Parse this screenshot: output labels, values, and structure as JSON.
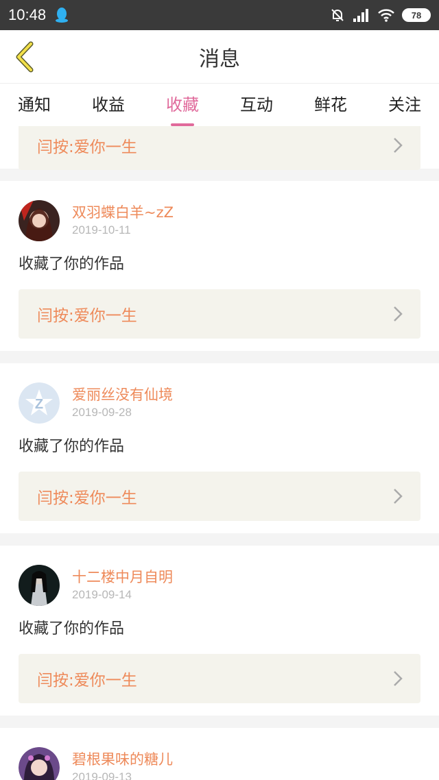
{
  "status": {
    "time": "10:48",
    "battery": "78"
  },
  "header": {
    "title": "消息"
  },
  "tabs": [
    {
      "label": "通知"
    },
    {
      "label": "收益"
    },
    {
      "label": "收藏"
    },
    {
      "label": "互动"
    },
    {
      "label": "鲜花"
    },
    {
      "label": "关注"
    }
  ],
  "active_tab": "收藏",
  "colors": {
    "accent": "#e06a9b",
    "name": "#ee8a5a",
    "link_bg": "#f4f3ec"
  },
  "partial_card": {
    "work_title": "闫按:爱你一生"
  },
  "cards": [
    {
      "username": "双羽蝶白羊~zZ",
      "date": "2019-10-11",
      "action": "收藏了你的作品",
      "work_title": "闫按:爱你一生"
    },
    {
      "username": "爱丽丝没有仙境",
      "date": "2019-09-28",
      "action": "收藏了你的作品",
      "work_title": "闫按:爱你一生"
    },
    {
      "username": "十二楼中月自明",
      "date": "2019-09-14",
      "action": "收藏了你的作品",
      "work_title": "闫按:爱你一生"
    },
    {
      "username": "碧根果味的糖儿",
      "date": "2019-09-13"
    }
  ]
}
